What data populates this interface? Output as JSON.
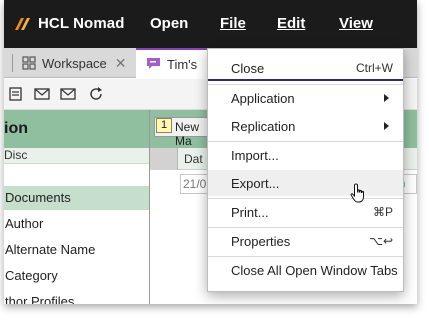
{
  "app": {
    "name": "HCL Nomad"
  },
  "menubar": {
    "items": [
      {
        "label": "Open",
        "accel": ""
      },
      {
        "label": "File",
        "accel": "F"
      },
      {
        "label": "Edit",
        "accel": "E"
      },
      {
        "label": "View",
        "accel": "V"
      }
    ]
  },
  "tabs": [
    {
      "label": "Workspace",
      "icon": "grid-icon",
      "closable": true
    },
    {
      "label": "Tim's",
      "icon": "chat-icon",
      "closable": false
    }
  ],
  "left_panel": {
    "title": "ion",
    "subheader": "Disc",
    "items": [
      {
        "label": "Documents",
        "selected": true
      },
      {
        "label": "Author",
        "selected": false
      },
      {
        "label": "Alternate Name",
        "selected": false
      },
      {
        "label": "Category",
        "selected": false
      },
      {
        "label": "thor Profiles",
        "selected": false
      }
    ]
  },
  "right_panel": {
    "badge": "1",
    "button_label": "New Ma",
    "column_label": "Dat",
    "row_date": "21/0",
    "row_green_text": "n"
  },
  "file_menu": {
    "items": [
      {
        "label": "Close",
        "shortcut": "Ctrl+W",
        "submenu": false
      },
      {
        "label": "Application",
        "shortcut": "",
        "submenu": true
      },
      {
        "label": "Replication",
        "shortcut": "",
        "submenu": true
      },
      {
        "label": "Import...",
        "shortcut": "",
        "submenu": false
      },
      {
        "label": "Export...",
        "shortcut": "",
        "submenu": false
      },
      {
        "label": "Print...",
        "shortcut": "⌘P",
        "submenu": false
      },
      {
        "label": "Properties",
        "shortcut": "⌥↩",
        "submenu": false
      },
      {
        "label": "Close All Open Window Tabs",
        "shortcut": "",
        "submenu": false
      }
    ]
  },
  "colors": {
    "menubar_bg": "#1b1b1b",
    "accent_green": "#8fbf9f",
    "selected_green": "#c5dfcc",
    "tab_accent": "#8e44ad",
    "logo_orange": "#f08a24"
  }
}
